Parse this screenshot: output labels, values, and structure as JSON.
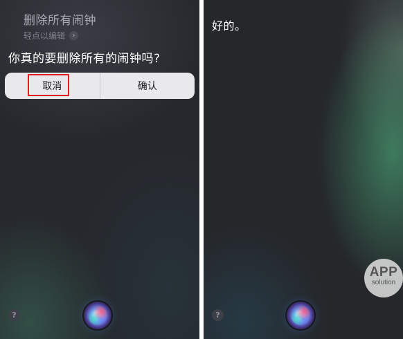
{
  "left_screen": {
    "utterance": "删除所有闹钟",
    "edit_hint": "轻点以编辑",
    "edit_chevron": "›",
    "question": "你真的要删除所有的闹钟吗?",
    "dialog": {
      "cancel_label": "取消",
      "confirm_label": "确认"
    },
    "help_glyph": "?",
    "highlight_color": "#e01b22"
  },
  "right_screen": {
    "response": "好的。",
    "help_glyph": "?",
    "watermark": {
      "top": "APP",
      "bottom": "solution"
    }
  },
  "icons": {
    "siri": "siri-orb-icon",
    "help": "help-icon",
    "chevron": "chevron-right-icon"
  }
}
